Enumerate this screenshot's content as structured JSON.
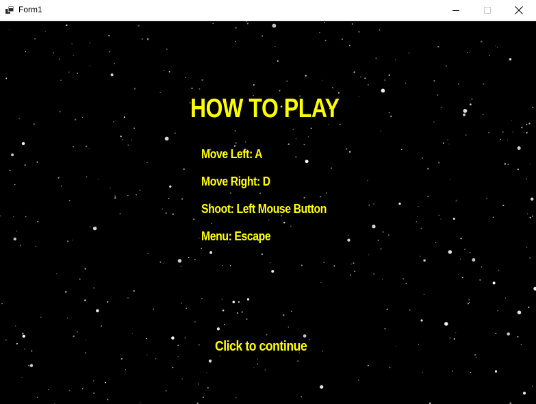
{
  "window": {
    "title": "Form1",
    "icons": {
      "app": "app-window-icon",
      "minimize": "minimize-icon",
      "maximize": "maximize-icon",
      "close": "close-icon"
    }
  },
  "screen": {
    "heading": "HOW TO PLAY",
    "controls": [
      "Move Left: A",
      "Move Right: D",
      "Shoot: Left Mouse Button",
      "Menu: Escape"
    ],
    "continue_prompt": "Click to continue"
  },
  "colors": {
    "text": "#ffff00",
    "background": "#000000",
    "stars": "#ffffff"
  }
}
